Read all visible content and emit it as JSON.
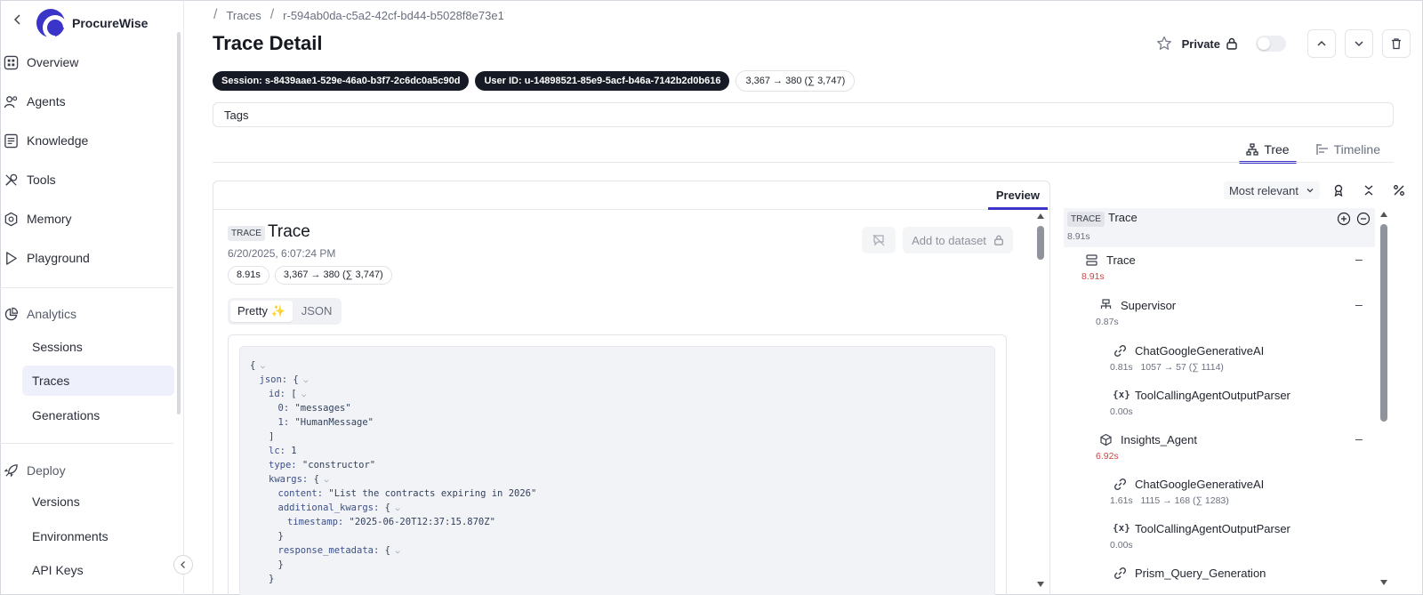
{
  "brand": {
    "name": "ProcureWise"
  },
  "sidebar": {
    "items": [
      {
        "label": "Overview",
        "icon": "grid-icon"
      },
      {
        "label": "Agents",
        "icon": "agents-icon"
      },
      {
        "label": "Knowledge",
        "icon": "document-icon"
      },
      {
        "label": "Tools",
        "icon": "tools-icon"
      },
      {
        "label": "Memory",
        "icon": "memory-icon"
      },
      {
        "label": "Playground",
        "icon": "play-icon"
      }
    ],
    "analytics": {
      "label": "Analytics",
      "icon": "pie-chart-icon",
      "children": [
        "Sessions",
        "Traces",
        "Generations"
      ],
      "active": "Traces"
    },
    "deploy": {
      "label": "Deploy",
      "icon": "rocket-icon",
      "children": [
        "Versions",
        "Environments",
        "API Keys"
      ]
    }
  },
  "breadcrumb": {
    "section": "Traces",
    "id": "r-594ab0da-c5a2-42cf-bd44-b5028f8e73e1"
  },
  "header": {
    "title": "Trace Detail",
    "private_label": "Private"
  },
  "chips": {
    "session": "Session: s-8439aae1-529e-46a0-b3f7-2c6dc0a5c90d",
    "user": "User ID: u-14898521-85e9-5acf-b46a-7142b2d0b616",
    "tokens": "3,367 → 380 (∑ 3,747)"
  },
  "tags": {
    "label": "Tags"
  },
  "view_tabs": {
    "tree": "Tree",
    "timeline": "Timeline",
    "active": "Tree"
  },
  "preview": {
    "tab": "Preview",
    "badge": "TRACE",
    "name": "Trace",
    "date": "6/20/2025, 6:07:24 PM",
    "duration": "8.91s",
    "tokens": "3,367 → 380 (∑ 3,747)",
    "add_dataset": "Add to dataset",
    "format_tabs": {
      "pretty": "Pretty ✨",
      "json": "JSON"
    }
  },
  "code_lines": [
    {
      "indent": 0,
      "text": "{",
      "caret": true
    },
    {
      "indent": 1,
      "key": "json:",
      "text": " {",
      "caret": true
    },
    {
      "indent": 2,
      "key": "id:",
      "text": " [",
      "caret": true
    },
    {
      "indent": 3,
      "key": "0:",
      "text": " \"messages\""
    },
    {
      "indent": 3,
      "key": "1:",
      "text": " \"HumanMessage\""
    },
    {
      "indent": 2,
      "text": "]"
    },
    {
      "indent": 2,
      "key": "lc:",
      "text": " 1"
    },
    {
      "indent": 2,
      "key": "type:",
      "text": " \"constructor\""
    },
    {
      "indent": 2,
      "key": "kwargs:",
      "text": " {",
      "caret": true
    },
    {
      "indent": 3,
      "key": "content:",
      "text": " \"List the contracts expiring in 2026\""
    },
    {
      "indent": 3,
      "key": "additional_kwargs:",
      "text": " {",
      "caret": true
    },
    {
      "indent": 4,
      "key": "timestamp:",
      "text": " \"2025-06-20T12:37:15.870Z\""
    },
    {
      "indent": 3,
      "text": "}"
    },
    {
      "indent": 3,
      "key": "response_metadata:",
      "text": " {",
      "caret": true
    },
    {
      "indent": 3,
      "text": "}"
    },
    {
      "indent": 2,
      "text": "}"
    }
  ],
  "tree": {
    "sort": "Most relevant",
    "root": {
      "badge": "TRACE",
      "name": "Trace",
      "duration": "8.91s"
    },
    "nodes": [
      {
        "name": "Trace",
        "meta": "8.91s",
        "red": true,
        "icon": "layers-icon"
      },
      {
        "name": "Supervisor",
        "meta": "0.87s",
        "red": false,
        "icon": "hierarchy-icon"
      },
      {
        "name": "ChatGoogleGenerativeAI",
        "meta": "0.81s   1057 → 57 (∑ 1114)",
        "red": false,
        "icon": "link-icon"
      },
      {
        "name": "ToolCallingAgentOutputParser",
        "meta": "0.00s",
        "red": false,
        "icon": "function-icon"
      },
      {
        "name": "Insights_Agent",
        "meta": "6.92s",
        "red": true,
        "icon": "cube-icon"
      },
      {
        "name": "ChatGoogleGenerativeAI",
        "meta": "1.61s   1115 → 168 (∑ 1283)",
        "red": false,
        "icon": "link-icon"
      },
      {
        "name": "ToolCallingAgentOutputParser",
        "meta": "0.00s",
        "red": false,
        "icon": "function-icon"
      },
      {
        "name": "Prism_Query_Generation",
        "meta": "",
        "red": false,
        "icon": "link-icon"
      }
    ]
  }
}
